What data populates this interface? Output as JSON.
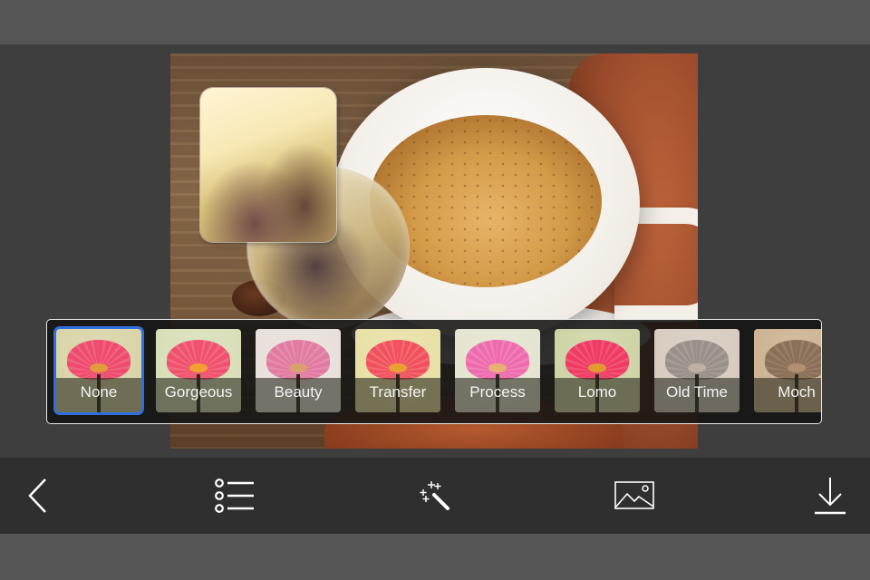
{
  "app": {
    "screen": "Photo frame editor - filter selection"
  },
  "canvas": {
    "description": "Coffee cup background photo with couple photo placed inside rounded-rectangle and circular frames"
  },
  "filters": {
    "selected_index": 0,
    "accent_color": "#2f6fe0",
    "items": [
      {
        "label": "None",
        "tint": "#d9d4a8",
        "flower": "#f04a70",
        "center": "#e39a3a"
      },
      {
        "label": "Gorgeous",
        "tint": "#d8dfb8",
        "flower": "#f2506e",
        "center": "#f0a030"
      },
      {
        "label": "Beauty",
        "tint": "#e8e0da",
        "flower": "#e27aa2",
        "center": "#d8a070"
      },
      {
        "label": "Transfer",
        "tint": "#e8e0a6",
        "flower": "#f25060",
        "center": "#e8a030"
      },
      {
        "label": "Process",
        "tint": "#e4e4d0",
        "flower": "#f06ab0",
        "center": "#e8b070"
      },
      {
        "label": "Lomo",
        "tint": "#cfd4a6",
        "flower": "#f23a66",
        "center": "#e09a30"
      },
      {
        "label": "Old Time",
        "tint": "#d8ccc0",
        "flower": "#9a908a",
        "center": "#c0b0a0"
      },
      {
        "label": "Moch",
        "tint": "#cdb392",
        "flower": "#8a7058",
        "center": "#b09070"
      }
    ]
  },
  "toolbar": {
    "items": [
      {
        "name": "back",
        "icon": "chevron-left-icon"
      },
      {
        "name": "frames-list",
        "icon": "list-icon"
      },
      {
        "name": "effects",
        "icon": "magic-wand-icon"
      },
      {
        "name": "background-image",
        "icon": "image-icon"
      },
      {
        "name": "save",
        "icon": "download-icon"
      }
    ]
  }
}
